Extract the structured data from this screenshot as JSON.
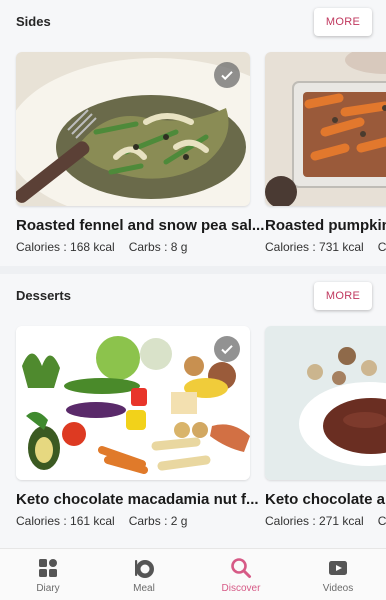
{
  "sections": [
    {
      "title": "Sides",
      "more_label": "MORE",
      "cards": [
        {
          "title": "Roasted fennel and snow pea salad",
          "title_display": "Roasted fennel and snow pea sal...",
          "calories": "Calories : 168 kcal",
          "carbs": "Carbs : 8 g",
          "checked": true
        },
        {
          "title": "Roasted pumpkin",
          "calories": "Calories : 731 kcal",
          "carbs": "Ca"
        }
      ]
    },
    {
      "title": "Desserts",
      "more_label": "MORE",
      "cards": [
        {
          "title": "Keto chocolate macadamia nut f...",
          "calories": "Calories : 161 kcal",
          "carbs": "Carbs : 2 g",
          "checked": true
        },
        {
          "title": "Keto chocolate an",
          "calories": "Calories : 271 kcal",
          "carbs": "Ca"
        }
      ]
    }
  ],
  "nav": {
    "active": "Discover",
    "items": [
      {
        "label": "Diary",
        "icon": "grid-icon"
      },
      {
        "label": "Meal",
        "icon": "plate-icon"
      },
      {
        "label": "Discover",
        "icon": "search-icon"
      },
      {
        "label": "Videos",
        "icon": "play-icon"
      }
    ]
  },
  "colors": {
    "accent": "#d65a86",
    "more_text": "#c0395f",
    "background": "#f6f7f9"
  }
}
